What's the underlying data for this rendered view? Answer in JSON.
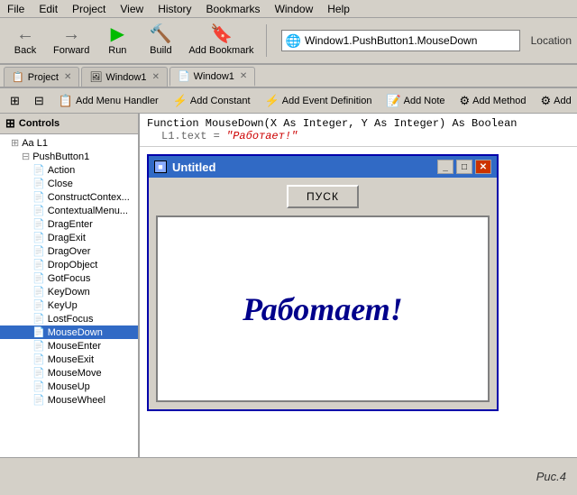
{
  "menubar": {
    "items": [
      "File",
      "Edit",
      "Project",
      "View",
      "History",
      "Bookmarks",
      "Window",
      "Help"
    ]
  },
  "toolbar": {
    "buttons": [
      {
        "id": "back",
        "icon": "←",
        "label": "Back"
      },
      {
        "id": "forward",
        "icon": "→",
        "label": "Forward"
      },
      {
        "id": "run",
        "icon": "▶",
        "label": "Run"
      },
      {
        "id": "build",
        "icon": "🔨",
        "label": "Build"
      },
      {
        "id": "bookmark",
        "icon": "🔖",
        "label": "Add Bookmark"
      }
    ],
    "location_icon": "🌐",
    "location_text": "Window1.PushButton1.MouseDown",
    "location_label": "Location"
  },
  "tabs": [
    {
      "id": "project",
      "label": "Project",
      "icon": "📋",
      "active": false
    },
    {
      "id": "window1-design",
      "label": "Window1",
      "icon": "🖼",
      "active": false
    },
    {
      "id": "window1-code",
      "label": "Window1",
      "icon": "📄",
      "active": true
    }
  ],
  "ide_toolbar": {
    "buttons": [
      {
        "id": "grid1",
        "icon": "⊞",
        "label": ""
      },
      {
        "id": "grid2",
        "icon": "⊟",
        "label": ""
      },
      {
        "id": "add-menu-handler",
        "icon": "📋",
        "label": "Add Menu Handler"
      },
      {
        "id": "add-constant",
        "icon": "⚡",
        "label": "Add Constant"
      },
      {
        "id": "add-event-def",
        "icon": "⚡",
        "label": "Add Event Definition"
      },
      {
        "id": "add-note",
        "icon": "📝",
        "label": "Add Note"
      },
      {
        "id": "add-method",
        "icon": "⚙",
        "label": "Add Method"
      },
      {
        "id": "add-more",
        "icon": "⚙",
        "label": "Add"
      }
    ]
  },
  "left_panel": {
    "header": "Controls",
    "tree": [
      {
        "level": 1,
        "icon": "⊞",
        "label": "Aa L1"
      },
      {
        "level": 2,
        "icon": "⊟",
        "label": "PushButton1",
        "expanded": true
      },
      {
        "level": 3,
        "icon": "📄",
        "label": "Action",
        "selected": false
      },
      {
        "level": 3,
        "icon": "📄",
        "label": "Close"
      },
      {
        "level": 3,
        "icon": "📄",
        "label": "ConstructContex..."
      },
      {
        "level": 3,
        "icon": "📄",
        "label": "ContextualMenu..."
      },
      {
        "level": 3,
        "icon": "📄",
        "label": "DragEnter"
      },
      {
        "level": 3,
        "icon": "📄",
        "label": "DragExit"
      },
      {
        "level": 3,
        "icon": "📄",
        "label": "DragOver"
      },
      {
        "level": 3,
        "icon": "📄",
        "label": "DropObject"
      },
      {
        "level": 3,
        "icon": "📄",
        "label": "GotFocus"
      },
      {
        "level": 3,
        "icon": "📄",
        "label": "KeyDown"
      },
      {
        "level": 3,
        "icon": "📄",
        "label": "KeyUp"
      },
      {
        "level": 3,
        "icon": "📄",
        "label": "LostFocus"
      },
      {
        "level": 3,
        "icon": "📄",
        "label": "MouseDown",
        "selected": true
      },
      {
        "level": 3,
        "icon": "📄",
        "label": "MouseEnter"
      },
      {
        "level": 3,
        "icon": "📄",
        "label": "MouseExit"
      },
      {
        "level": 3,
        "icon": "📄",
        "label": "MouseMove"
      },
      {
        "level": 3,
        "icon": "📄",
        "label": "MouseUp"
      },
      {
        "level": 3,
        "icon": "📄",
        "label": "MouseWheel"
      }
    ]
  },
  "code": {
    "function_signature": "Function MouseDown(X As Integer, Y As Integer) As Boolean",
    "code_line": "L1.text = \"Работает!\""
  },
  "preview": {
    "title": "Untitled",
    "button_label": "ПУСК",
    "label_text": "Работает!"
  },
  "bottom": {
    "caption": "Рис.4"
  }
}
